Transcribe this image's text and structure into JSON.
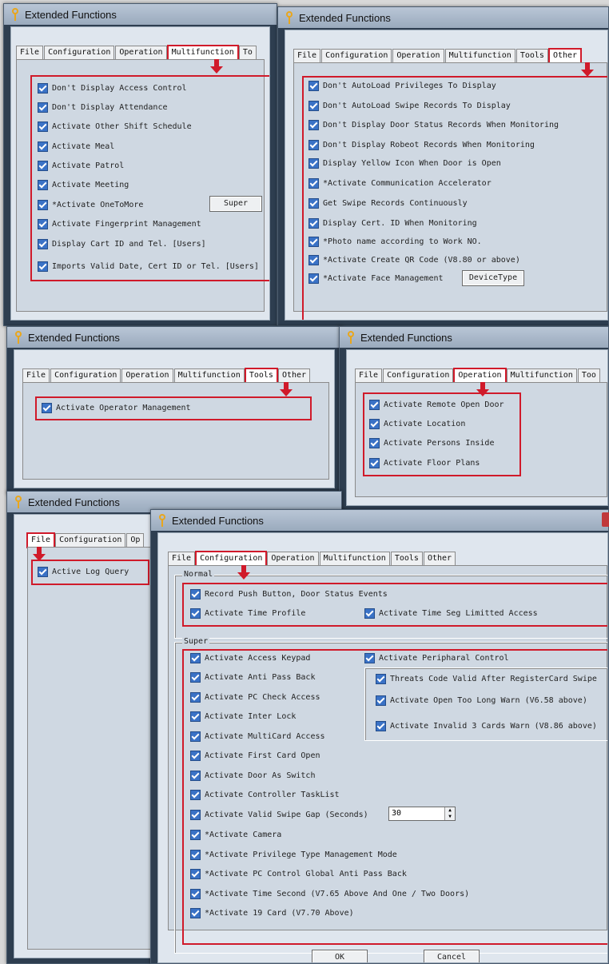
{
  "window_title": "Extended Functions",
  "tabs_full": [
    "File",
    "Configuration",
    "Operation",
    "Multifunction",
    "Tools",
    "Other"
  ],
  "win1": {
    "tabs": [
      "File",
      "Configuration",
      "Operation",
      "Multifunction",
      "To"
    ],
    "active": "Multifunction",
    "items": [
      "Don't Display Access Control",
      "Don't Display Attendance",
      "Activate Other Shift Schedule",
      "Activate Meal",
      "Activate Patrol",
      "Activate Meeting",
      "*Activate OneToMore",
      "Activate Fingerprint Management",
      "Display Cart ID and Tel. [Users]",
      "Imports Valid Date, Cert ID or Tel. [Users]"
    ],
    "super_button": "Super"
  },
  "win2": {
    "active": "Other",
    "items": [
      "Don't AutoLoad Privileges To Display",
      "Don't AutoLoad Swipe Records To Display",
      "Don't Display Door Status Records When Monitoring",
      "Don't Display Robeot Records When Monitoring",
      "Display Yellow Icon When Door is Open",
      "*Activate Communication Accelerator",
      "Get Swipe Records Continuously",
      "Display Cert. ID When Monitoring",
      "*Photo name according to Work NO.",
      "*Activate Create QR Code (V8.80 or above)",
      "*Activate Face Management"
    ],
    "device_button": "DeviceType"
  },
  "win3": {
    "tabs": [
      "File",
      "Configuration",
      "Operation",
      "Multifunction",
      "Tools",
      "Other"
    ],
    "active": "Tools",
    "items": [
      "Activate Operator Management"
    ]
  },
  "win4": {
    "tabs": [
      "File",
      "Configuration",
      "Operation",
      "Multifunction",
      "Too"
    ],
    "active": "Operation",
    "items": [
      "Activate Remote Open Door",
      "Activate Location",
      "Activate Persons Inside",
      "Activate Floor Plans"
    ]
  },
  "win5": {
    "tabs": [
      "File",
      "Configuration",
      "Op"
    ],
    "active": "File",
    "items": [
      "Active Log Query"
    ]
  },
  "win6": {
    "active": "Configuration",
    "normal_label": "Normal",
    "normal_items": [
      "Record Push Button, Door Status Events",
      "Activate Time Profile"
    ],
    "normal_right": "Activate Time Seg Limitted Access",
    "super_label": "Super",
    "super_items": [
      "Activate Access Keypad",
      "Activate Anti Pass Back",
      "Activate PC Check Access",
      "Activate Inter Lock",
      "Activate MultiCard Access",
      "Activate First Card Open",
      "Activate Door As Switch",
      "Activate Controller TaskList",
      "Activate Valid Swipe Gap (Seconds)",
      "*Activate Camera",
      "*Activate Privilege Type Management Mode",
      "*Activate PC Control Global Anti Pass Back",
      "*Activate Time Second (V7.65 Above And One / Two Doors)",
      "*Activate 19 Card (V7.70 Above)"
    ],
    "peripheral": "Activate Peripharal Control",
    "peripheral_items": [
      "Threats Code Valid After RegisterCard Swipe",
      "Activate Open Too Long Warn (V6.58 above)",
      "Activate Invalid 3 Cards  Warn (V8.86 above)"
    ],
    "swipe_gap_value": "30",
    "ok": "OK",
    "cancel": "Cancel"
  }
}
